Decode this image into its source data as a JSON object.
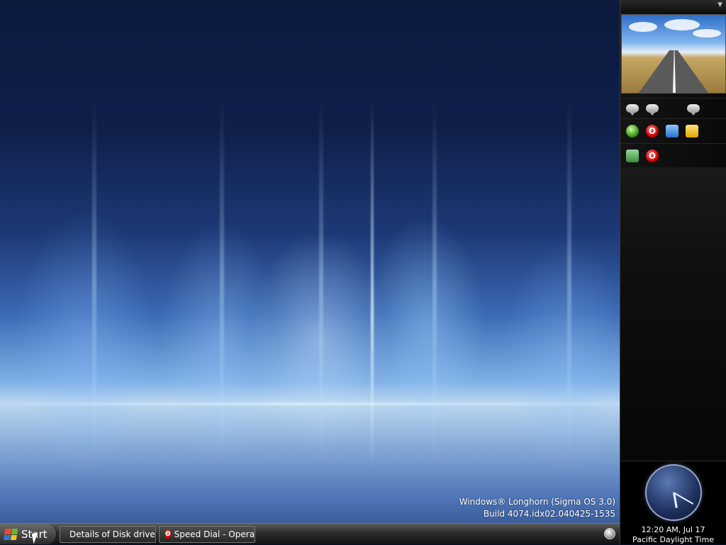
{
  "desktop": {
    "watermark_line1": "Windows® Longhorn (Sigma OS 3.0)",
    "watermark_line2": "Build 4074.idx02.040425-1535"
  },
  "taskbar": {
    "start_label": "Start",
    "tasks": [
      {
        "label": "Details of Disk drive",
        "icon": "disk-drive-icon"
      },
      {
        "label": "Speed Dial - Opera",
        "icon": "opera-icon"
      }
    ]
  },
  "sidebar": {
    "quick_launch_row1": [
      "green-orb-icon",
      "opera-icon",
      "monitor-icon",
      "folder-icon"
    ],
    "quick_launch_row2": [
      "security-shield-icon",
      "opera-icon"
    ],
    "clock": {
      "time": "12:20 AM, Jul 17",
      "timezone": "Pacific Daylight Time"
    }
  },
  "colors": {
    "desktop_dark": "#0c1a3e",
    "desktop_glow": "#bcd7f0",
    "sidebar_bg": "#0f0f0f",
    "taskbar_bg": "#2c2c2c"
  }
}
